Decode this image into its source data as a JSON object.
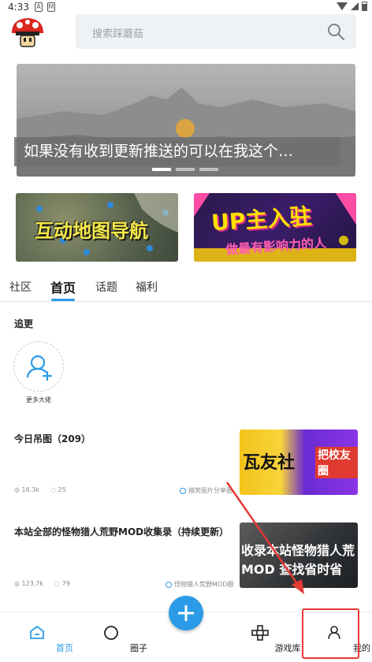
{
  "status_bar": {
    "time": "4:33",
    "icon_a": "A",
    "icon_m": "M"
  },
  "search": {
    "placeholder": "搜索踩蘑菇"
  },
  "banner": {
    "caption": "如果没有收到更新推送的可以在我这个…",
    "dots": 3,
    "active_dot": 0
  },
  "promos": [
    {
      "title": "互动地图导航",
      "subtitle": ""
    },
    {
      "title": "UP主入驻",
      "subtitle": "做最有影响力的人"
    }
  ],
  "tabs": [
    {
      "label": "社区",
      "active": false
    },
    {
      "label": "首页",
      "active": true
    },
    {
      "label": "话题",
      "active": false
    },
    {
      "label": "福利",
      "active": false
    }
  ],
  "follow": {
    "title": "追更",
    "more_label": "更多大佬"
  },
  "posts": [
    {
      "title": "今日吊图（209）",
      "views": "16.3k",
      "comments": "25",
      "group": "搞笑图片分享圈",
      "thumb_text_1": "瓦友社",
      "thumb_text_2": "把校友圈"
    },
    {
      "title": "本站全部的怪物猎人荒野MOD收集录（持续更新）",
      "views": "123.7k",
      "comments": "79",
      "group": "怪物猎人荒野MOD圈",
      "thumb_text_1": "收录本站怪物猎人荒",
      "thumb_text_2": "MOD 查找省时省"
    }
  ],
  "bottom_nav": [
    {
      "label": "首页",
      "icon": "home-icon",
      "active": true
    },
    {
      "label": "圈子",
      "icon": "circle-icon",
      "active": false
    },
    {
      "label": "游戏库",
      "icon": "gamepad-icon",
      "active": false
    },
    {
      "label": "我的",
      "icon": "user-icon",
      "active": false
    }
  ],
  "colors": {
    "accent": "#2b9be8",
    "annotation": "#e53935"
  }
}
